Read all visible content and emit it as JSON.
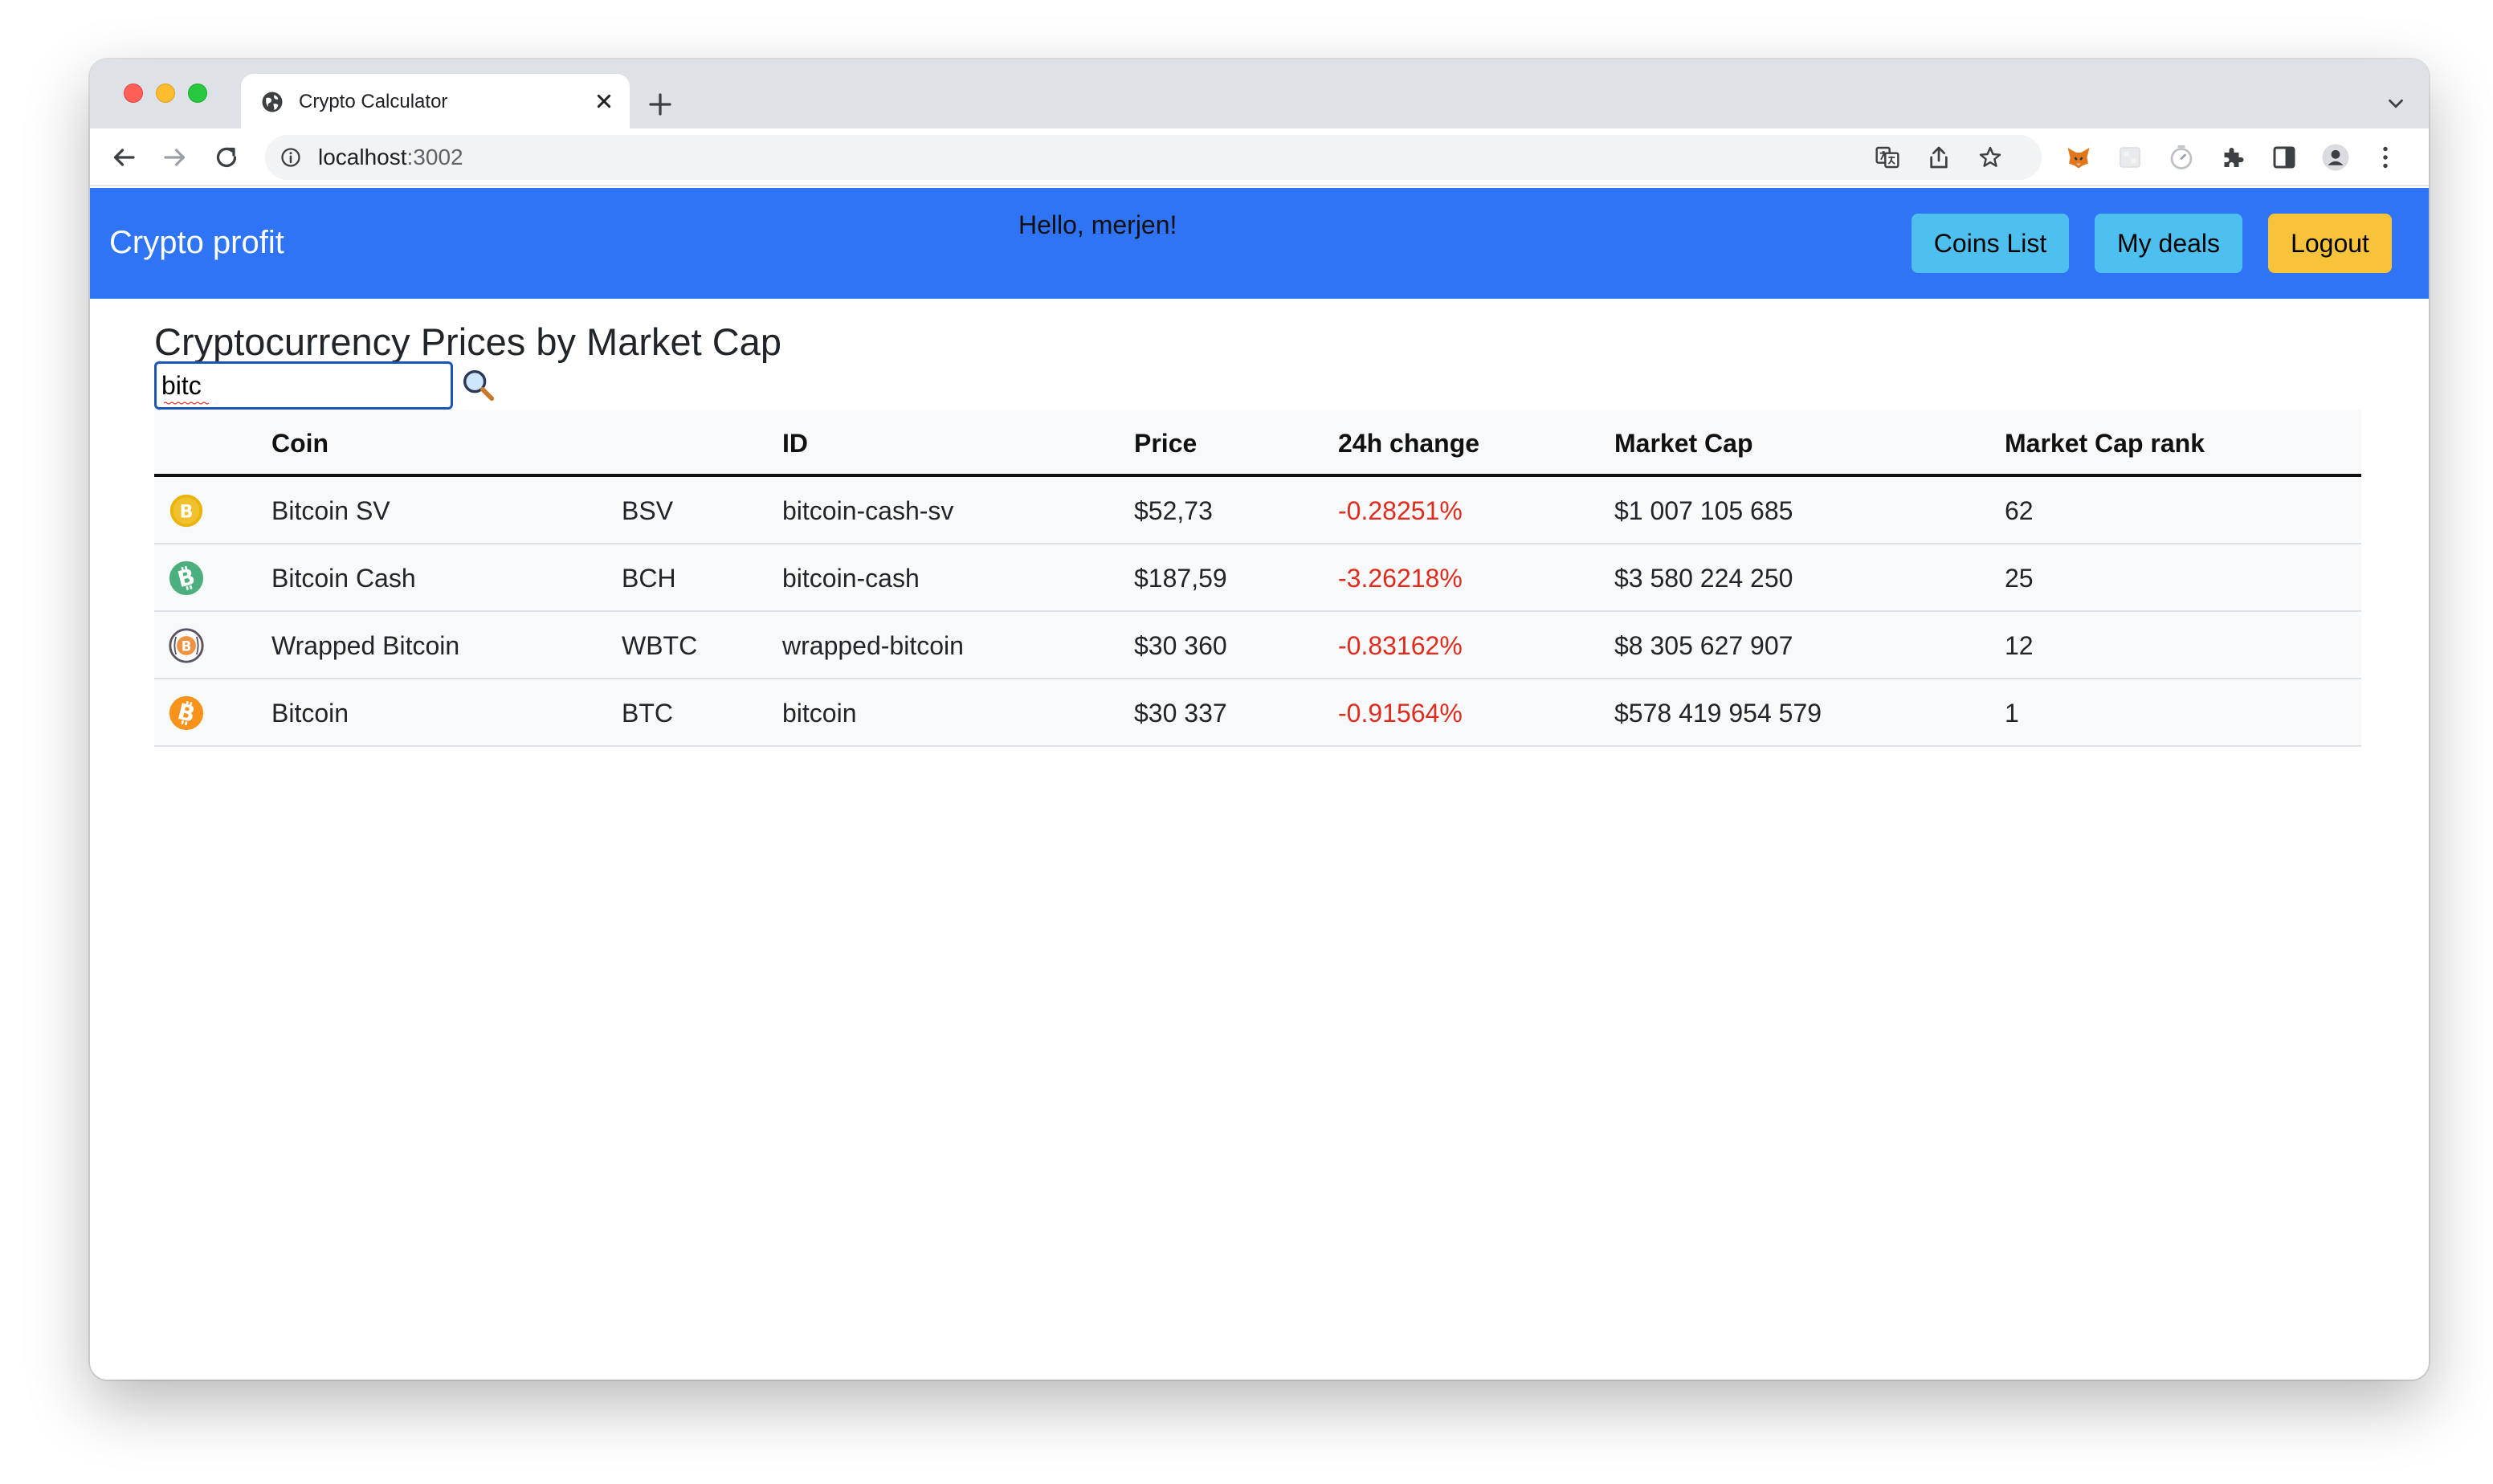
{
  "browser": {
    "tab_title": "Crypto Calculator",
    "url_host": "localhost",
    "url_port": ":3002"
  },
  "navbar": {
    "brand": "Crypto profit",
    "greeting": "Hello, merjen!",
    "buttons": {
      "coins_list": "Coins List",
      "my_deals": "My deals",
      "logout": "Logout"
    },
    "colors": {
      "navbar_bg": "#2e74f4",
      "info_button": "#4ec0ef",
      "warning_button": "#f6c33a"
    }
  },
  "main": {
    "heading": "Cryptocurrency Prices by Market Cap",
    "search": {
      "value": "bitc"
    },
    "table": {
      "headers": {
        "image": "",
        "coin": "Coin",
        "symbol": "",
        "id": "ID",
        "price": "Price",
        "change": "24h change",
        "market_cap": "Market Cap",
        "rank": "Market Cap rank"
      },
      "rows": [
        {
          "icon": "bitcoin-sv-icon",
          "name": "Bitcoin SV",
          "symbol": "BSV",
          "id": "bitcoin-cash-sv",
          "price": "$52,73",
          "change": "-0.28251%",
          "market_cap": "$1 007 105 685",
          "rank": "62"
        },
        {
          "icon": "bitcoin-cash-icon",
          "name": "Bitcoin Cash",
          "symbol": "BCH",
          "id": "bitcoin-cash",
          "price": "$187,59",
          "change": "-3.26218%",
          "market_cap": "$3 580 224 250",
          "rank": "25"
        },
        {
          "icon": "wrapped-bitcoin-icon",
          "name": "Wrapped Bitcoin",
          "symbol": "WBTC",
          "id": "wrapped-bitcoin",
          "price": "$30 360",
          "change": "-0.83162%",
          "market_cap": "$8 305 627 907",
          "rank": "12"
        },
        {
          "icon": "bitcoin-icon",
          "name": "Bitcoin",
          "symbol": "BTC",
          "id": "bitcoin",
          "price": "$30 337",
          "change": "-0.91564%",
          "market_cap": "$578 419 954 579",
          "rank": "1"
        }
      ],
      "negative_color": "#e02c1f"
    }
  }
}
